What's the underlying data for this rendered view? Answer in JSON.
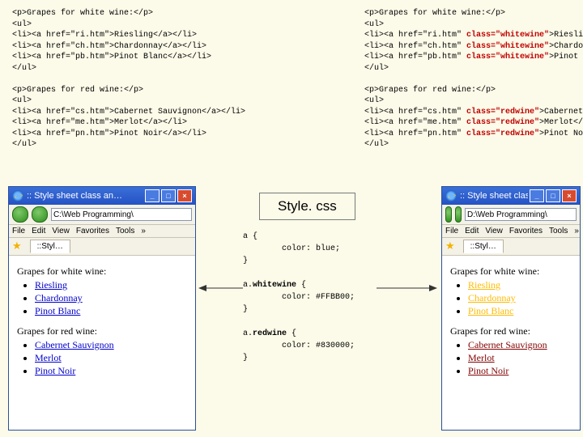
{
  "code_left_lines": [
    "<p>Grapes for white wine:</p>",
    "<ul>",
    "<li><a href=\"ri.htm\">Riesling</a></li>",
    "<li><a href=\"ch.htm\">Chardonnay</a></li>",
    "<li><a href=\"pb.htm\">Pinot Blanc</a></li>",
    "</ul>",
    "",
    "<p>Grapes for red wine:</p>",
    "<ul>",
    "<li><a href=\"cs.htm\">Cabernet Sauvignon</a></li>",
    "<li><a href=\"me.htm\">Merlot</a></li>",
    "<li><a href=\"pn.htm\">Pinot Noir</a></li>",
    "</ul>"
  ],
  "code_right_white_prefix": "<li><a href=\"",
  "code_right_white": [
    [
      "ri.htm",
      "Riesling"
    ],
    [
      "ch.htm",
      "Chardonnay"
    ],
    [
      "pb.htm",
      "Pinot Blanc"
    ]
  ],
  "code_right_red": [
    [
      "cs.htm",
      "Cabernet Sauvignon"
    ],
    [
      "me.htm",
      "Merlot"
    ],
    [
      "pn.htm",
      "Pinot Noir"
    ]
  ],
  "p_white": "<p>Grapes for white wine:</p>",
  "p_red": "<p>Grapes for red wine:</p>",
  "ul_open": "<ul>",
  "ul_close": "</ul>",
  "class_ww": " class=\"whitewine\"",
  "class_rw": " class=\"redwine\"",
  "close_a_li": "</a></li>",
  "css_box_label": "Style. css",
  "css_code": "a {\n        color: blue;\n}\n\na.|whitewine| {\n        color: #FFBB00;\n}\n\na.|redwine| {\n        color: #830000;\n}",
  "browser_title": ":: Style sheet class an…",
  "address_left": "C:\\Web Programming\\",
  "address_right": "D:\\Web Programming\\",
  "menus": [
    "File",
    "Edit",
    "View",
    "Favorites",
    "Tools"
  ],
  "menus_more": "»",
  "tab_left": "::Styl…",
  "tab_right": "::Styl…",
  "headings": {
    "white": "Grapes for white wine:",
    "red": "Grapes for red wine:"
  },
  "whites": [
    "Riesling",
    "Chardonnay",
    "Pinot Blanc"
  ],
  "reds": [
    "Cabernet Sauvignon",
    "Merlot",
    "Pinot Noir"
  ]
}
